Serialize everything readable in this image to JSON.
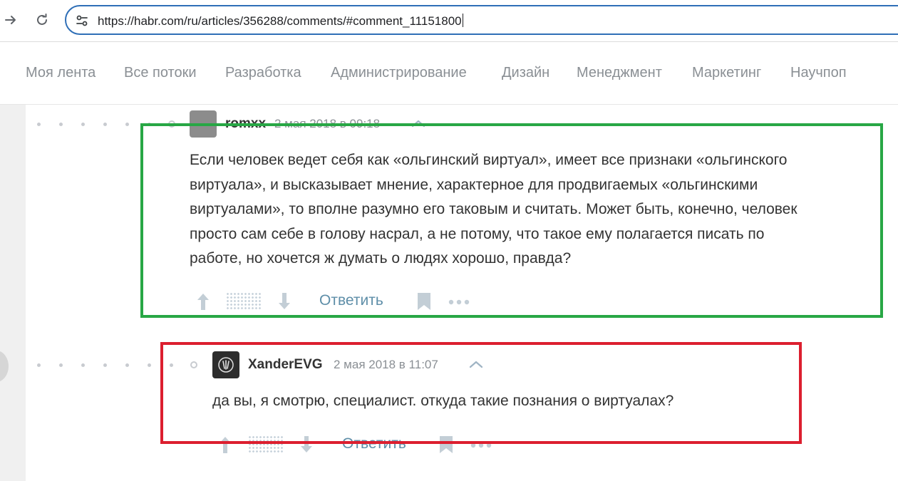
{
  "browser": {
    "url": "https://habr.com/ru/articles/356288/comments/#comment_11151800",
    "icons": [
      "forward-icon",
      "reload-icon",
      "site-info-icon"
    ]
  },
  "nav": {
    "items": [
      {
        "label": "Моя лента"
      },
      {
        "label": "Все потоки"
      },
      {
        "label": "Разработка"
      },
      {
        "label": "Администрирование"
      },
      {
        "label": "Дизайн"
      },
      {
        "label": "Менеджмент"
      },
      {
        "label": "Маркетинг"
      },
      {
        "label": "Научпоп"
      }
    ]
  },
  "comments": [
    {
      "author": "romxx",
      "date": "2 мая 2018 в 09:18",
      "lines": [
        "Если человек ведет себя как «ольгинский виртуал», имеет все признаки «ольгинского",
        "виртуала», и высказывает мнение, характерное для продвигаемых «ольгинскими",
        "виртуалами», то вполне разумно его таковым и считать. Может быть, конечно, человек",
        "просто сам себе в голову насрал, а не потому, что такое ему полагается писать по",
        "работе, но хочется ж думать о людях хорошо, правда?"
      ],
      "reply_label": "Ответить"
    },
    {
      "author": "XanderEVG",
      "date": "2 мая 2018 в 11:07",
      "lines": [
        "да вы, я смотрю, специалист. откуда такие познания о виртуалах?"
      ],
      "reply_label": "Ответить"
    }
  ],
  "colors": {
    "highlight_green": "#28a745",
    "highlight_red": "#dc1f2f",
    "address_border": "#2f6fb7",
    "reply_link": "#5e8ea8"
  }
}
